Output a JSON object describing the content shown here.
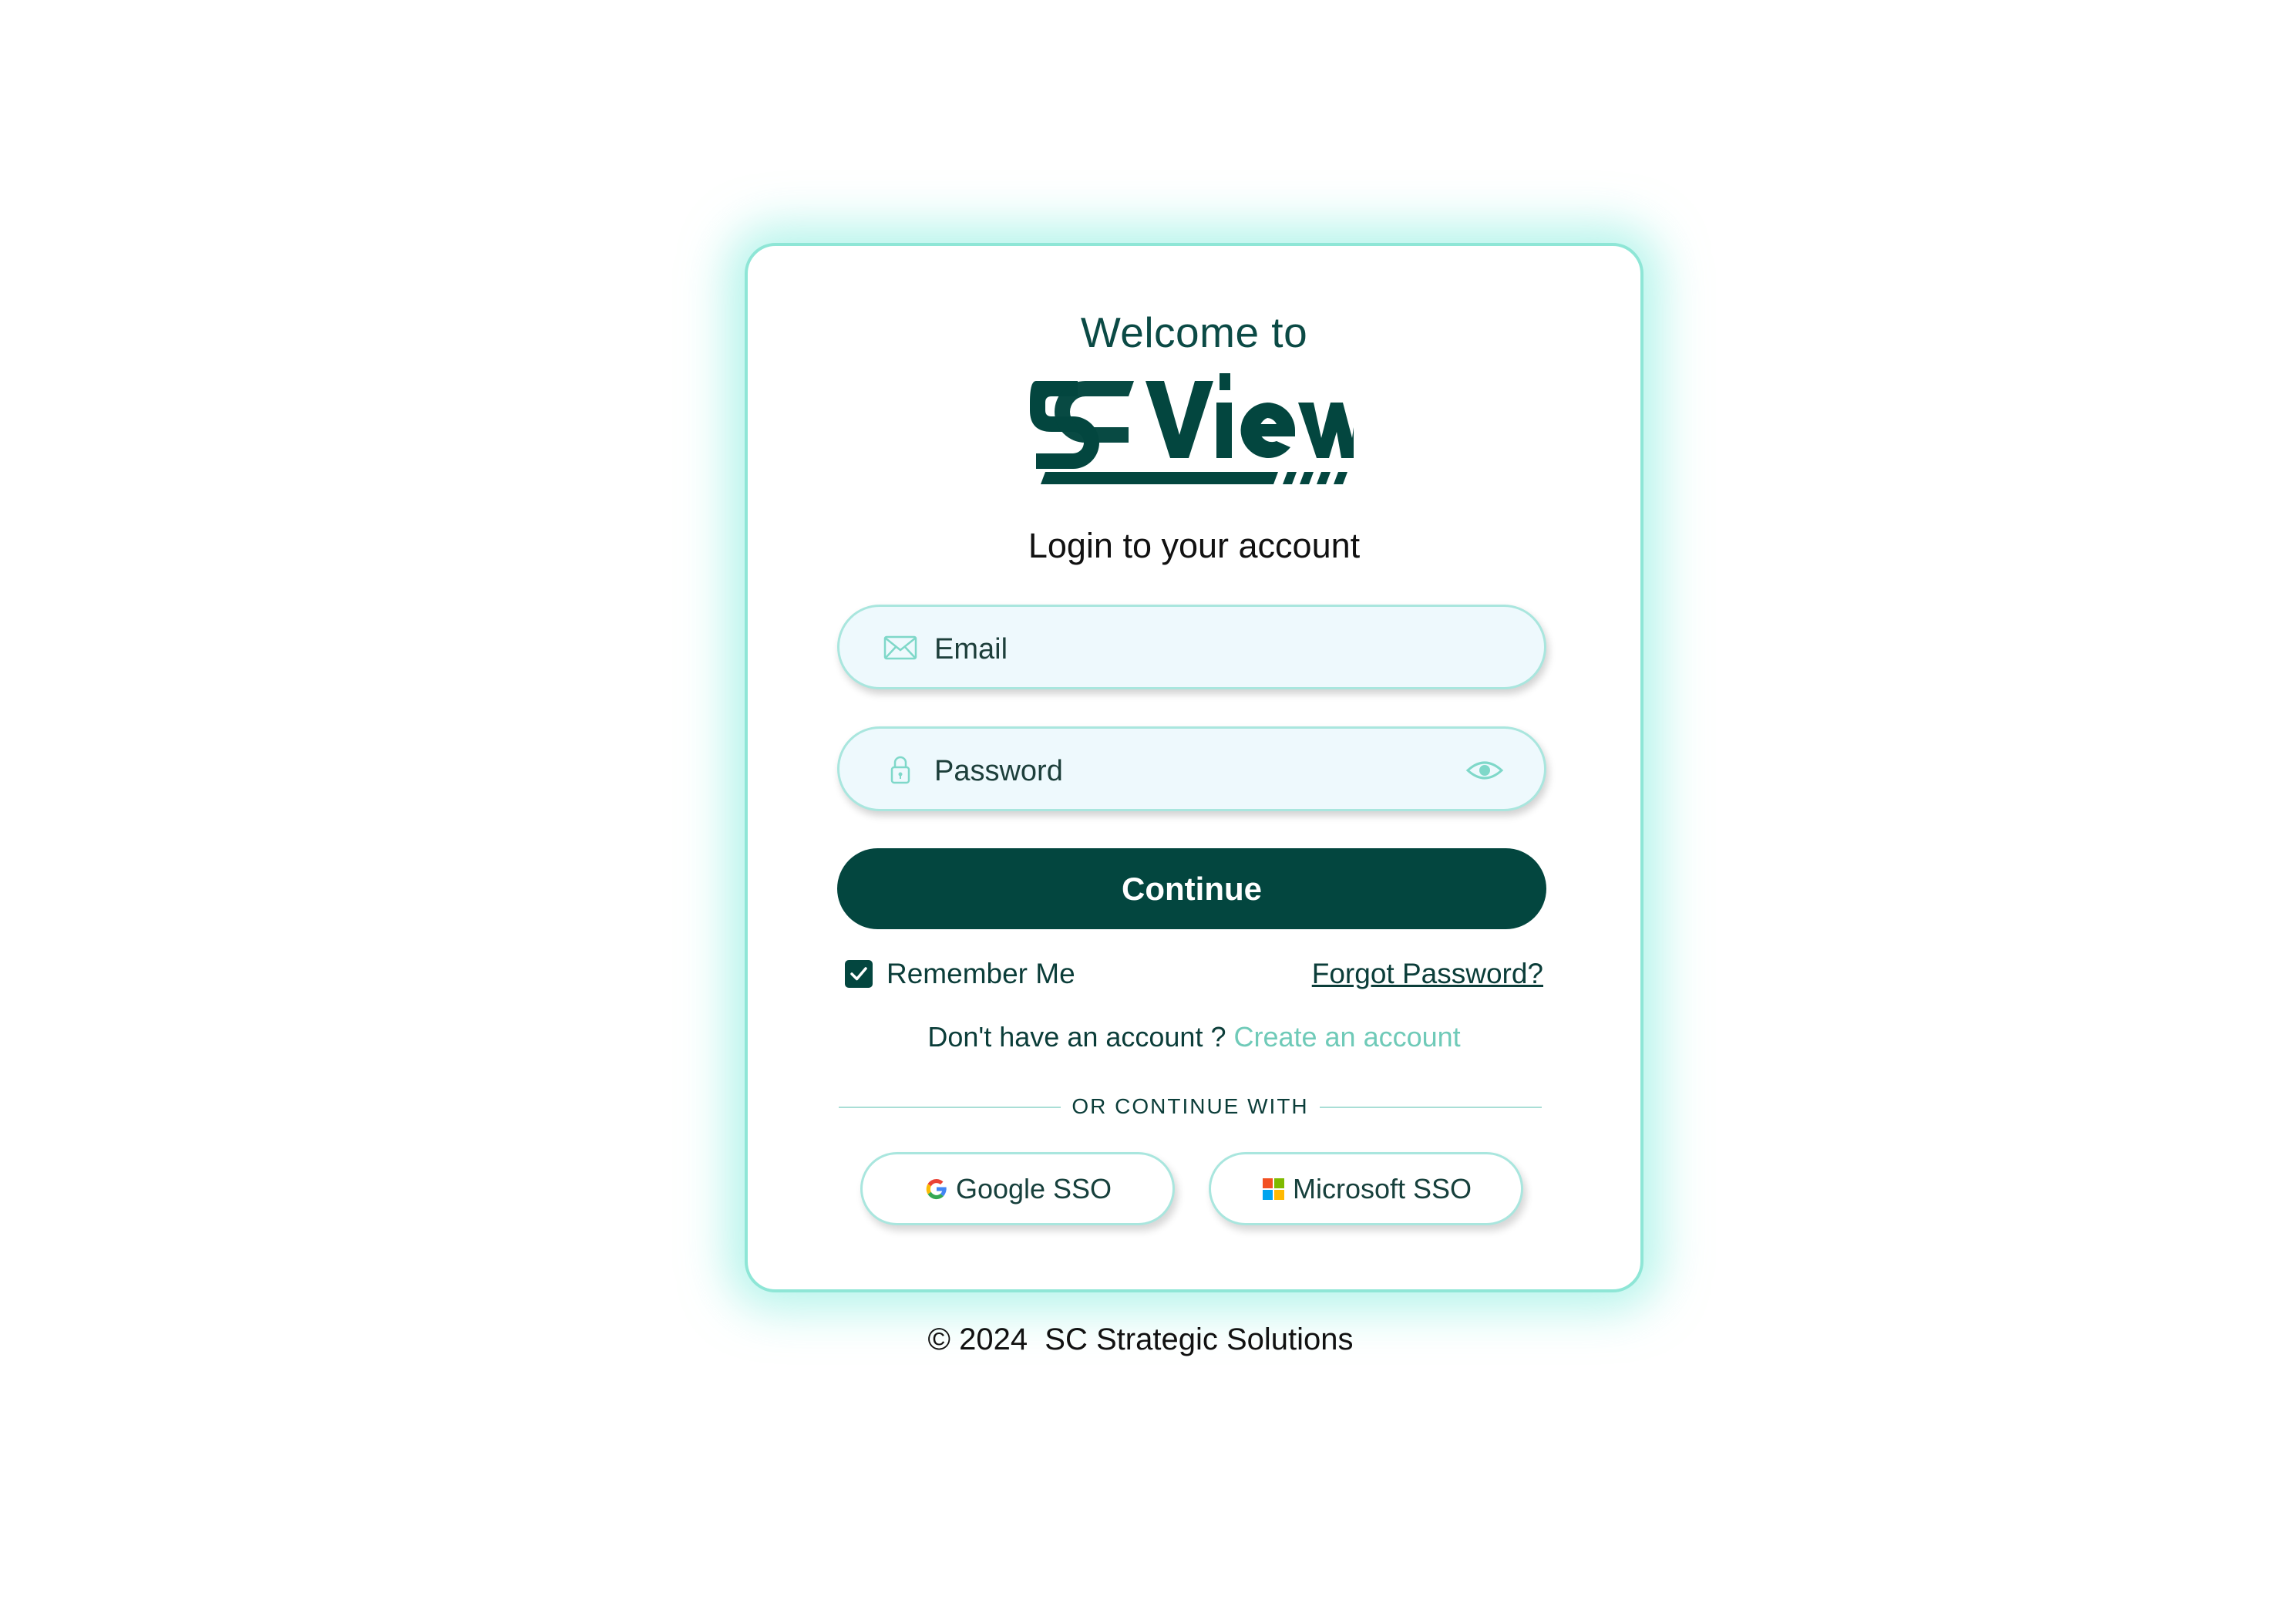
{
  "card": {
    "welcome": "Welcome to",
    "logo_text": "SCView",
    "subtitle": "Login to your account"
  },
  "form": {
    "email_placeholder": "Email",
    "email_value": "",
    "password_placeholder": "Password",
    "password_value": "",
    "continue_label": "Continue",
    "remember_label": "Remember Me",
    "remember_checked": true,
    "forgot_label": "Forgot Password?"
  },
  "signup": {
    "prompt": "Don't have an account ?",
    "link": "Create an account"
  },
  "divider": {
    "text": "OR CONTINUE WITH"
  },
  "sso": {
    "google_label": "Google SSO",
    "microsoft_label": "Microsoft SSO"
  },
  "footer": {
    "text": "© 2024  SC Strategic Solutions"
  },
  "icons": {
    "email": "mail-icon",
    "password": "lock-icon",
    "toggle": "eye-icon",
    "check": "check-icon",
    "google": "google-logo-icon",
    "microsoft": "microsoft-logo-icon"
  },
  "colors": {
    "brand": "#03463f",
    "accent": "#6fcab8",
    "border": "#a9e6de",
    "field_bg": "#eef9fd",
    "glow": "#78ebda"
  }
}
